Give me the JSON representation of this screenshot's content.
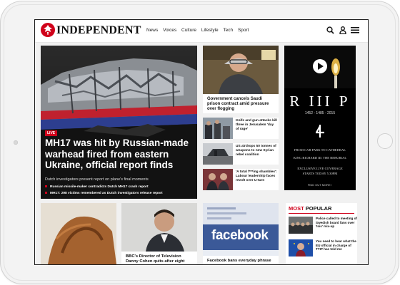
{
  "site": {
    "logo_text": "INDEPENDENT",
    "nav": [
      "News",
      "Voices",
      "Culture",
      "Lifestyle",
      "Tech",
      "Sport"
    ]
  },
  "hero": {
    "badge": "LIVE",
    "title": "MH17 was hit by Russian-made warhead fired from eastern Ukraine, official report finds",
    "subtitle": "Dutch investigators present report on plane's final moments",
    "related": [
      "Russian missile-maker contradicts Dutch MH17 crash report",
      "MH17: 298 victims remembered as Dutch investigators release report"
    ]
  },
  "middle": {
    "top_story": "Government cancels Saudi prison contract amid pressure over flogging",
    "stories": [
      "Knife and gun attacks kill three in Jerusalem 'day of rage'",
      "US airdrops 50 tonnes of weapons to new Syrian rebel coalition",
      "'A total f***ing shambles': Labour leadership faces revolt over U-turn"
    ]
  },
  "ad": {
    "title": "R III P",
    "dates": "1452 - 1485 - 2015",
    "lines": [
      "FROM CAR PARK TO CATHEDRAL",
      "KING RICHARD III: THE REBURIAL",
      "EXCLUSIVE LIVE COVERAGE",
      "STARTS TODAY 5.30PM"
    ],
    "cta": "FIND OUT MORE ›"
  },
  "bottom": {
    "bbc_title_line1": "BBC's Director of Television",
    "bbc_title_line2": "Danny Cohen quits after eight",
    "facebook_word": "facebook",
    "facebook_caption": "Facebook bans everyday phrase"
  },
  "most_popular": {
    "most": "MOST",
    "popular": " POPULAR",
    "items": [
      "Police called to meeting of Swedish board fans over 'Isis' mix-up",
      "You need to hear what the EU official in charge of TTIP has told me"
    ]
  },
  "colors": {
    "brand_red": "#d0021b",
    "facebook_blue": "#3b5998"
  }
}
